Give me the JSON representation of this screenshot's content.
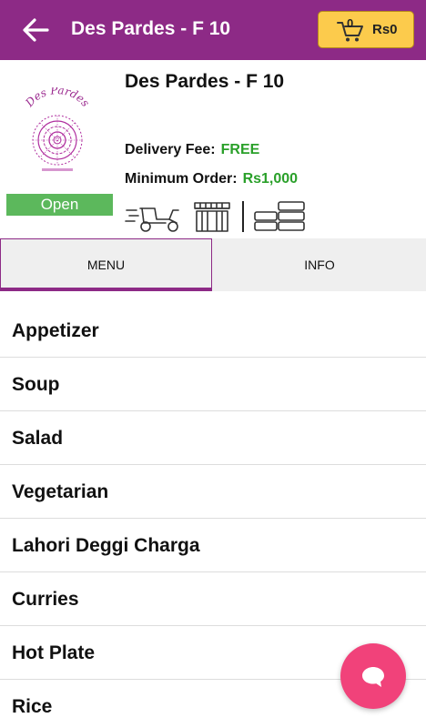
{
  "header": {
    "title": "Des Pardes - F 10",
    "cart": {
      "count": "0",
      "total": "Rs0"
    }
  },
  "restaurant": {
    "name": "Des Pardes - F 10",
    "logo_text": "Des Pardes",
    "status": "Open",
    "delivery_fee_label": "Delivery Fee:",
    "delivery_fee_value": "FREE",
    "minimum_order_label": "Minimum Order:",
    "minimum_order_value": "Rs1,000"
  },
  "tabs": [
    {
      "label": "MENU",
      "active": true
    },
    {
      "label": "INFO",
      "active": false
    }
  ],
  "categories": [
    "Appetizer",
    "Soup",
    "Salad",
    "Vegetarian",
    "Lahori Deggi Charga",
    "Curries",
    "Hot Plate",
    "Rice"
  ],
  "colors": {
    "brand": "#8d2a86",
    "cart_button": "#fccb4c",
    "open_badge": "#5cb85c",
    "highlight_value": "#2aa02a",
    "chat_button": "#f1427a"
  },
  "icons": {
    "back": "back-arrow-icon",
    "cart": "cart-icon",
    "delivery": "delivery-scooter-icon",
    "pickup": "storefront-icon",
    "payment": "cash-stack-icon",
    "chat": "chat-bubble-icon"
  }
}
